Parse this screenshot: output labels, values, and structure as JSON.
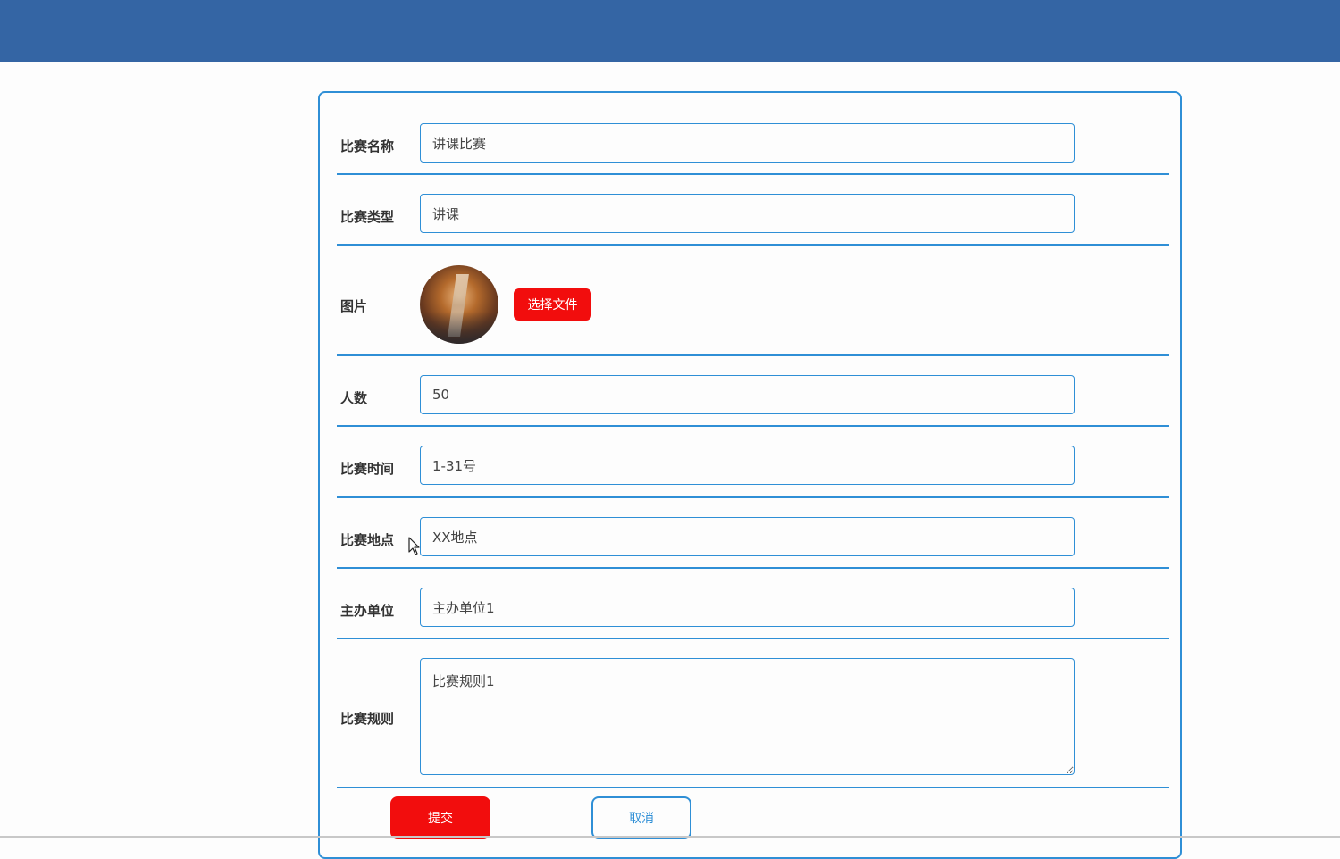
{
  "colors": {
    "header": "#3465a4",
    "accent": "#2f8fd6",
    "primary_button": "#f20d0d"
  },
  "form": {
    "fields": [
      {
        "label": "比赛名称",
        "value": "讲课比赛"
      },
      {
        "label": "比赛类型",
        "value": "讲课"
      },
      {
        "label": "图片",
        "button": "选择文件",
        "image_icon": "poster-thumbnail"
      },
      {
        "label": "人数",
        "value": "50"
      },
      {
        "label": "比赛时间",
        "value": "1-31号"
      },
      {
        "label": "比赛地点",
        "value": "XX地点"
      },
      {
        "label": "主办单位",
        "value": "主办单位1"
      },
      {
        "label": "比赛规则",
        "value": "比赛规则1"
      }
    ],
    "submit_label": "提交",
    "cancel_label": "取消"
  }
}
